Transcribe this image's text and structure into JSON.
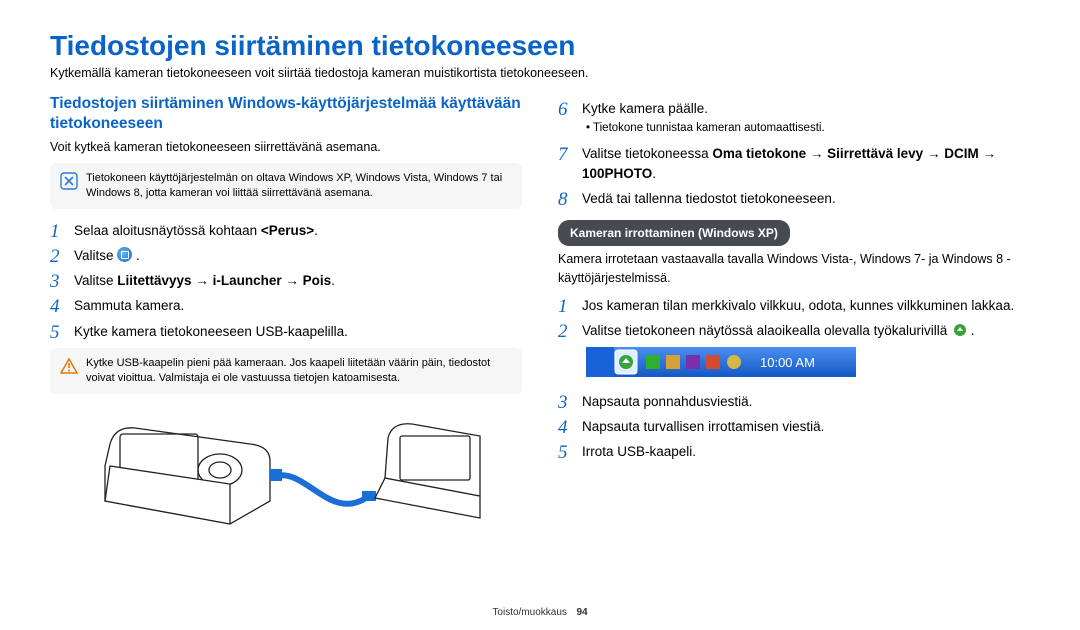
{
  "title": "Tiedostojen siirtäminen tietokoneeseen",
  "intro": "Kytkemällä kameran tietokoneeseen voit siirtää tiedostoja kameran muistikortista tietokoneeseen.",
  "left": {
    "heading": "Tiedostojen siirtäminen Windows-käyttöjärjestelmää käyttävään tietokoneeseen",
    "sub": "Voit kytkeä kameran tietokoneeseen siirrettävänä asemana.",
    "info1": "Tietokoneen käyttöjärjestelmän on oltava Windows XP, Windows Vista, Windows 7 tai Windows 8, jotta kameran voi liittää siirrettävänä asemana.",
    "s1a": "Selaa aloitusnäytössä kohtaan ",
    "s1b": "<Perus>",
    "s1c": ".",
    "s2": "Valitse ",
    "s2b": " .",
    "s3a": "Valitse ",
    "s3b": "Liitettävyys",
    "s3c": " → ",
    "s3d": "i-Launcher",
    "s3e": " → ",
    "s3f": "Pois",
    "s3g": ".",
    "s4": "Sammuta kamera.",
    "s5": "Kytke kamera tietokoneeseen USB-kaapelilla.",
    "warn": "Kytke USB-kaapelin pieni pää kameraan. Jos kaapeli liitetään väärin päin, tiedostot voivat vioittua. Valmistaja ei ole vastuussa tietojen katoamisesta."
  },
  "right": {
    "s6": "Kytke kamera päälle.",
    "s6b": "Tietokone tunnistaa kameran automaattisesti.",
    "s7a": "Valitse tietokoneessa ",
    "s7b": "Oma tietokone",
    "s7c": " → ",
    "s7d": "Siirrettävä levy",
    "s7e": " → ",
    "s7f": "DCIM",
    "s7g": " → ",
    "s7h": "100PHOTO",
    "s7i": ".",
    "s8": "Vedä tai tallenna tiedostot tietokoneeseen.",
    "pill": "Kameran irrottaminen (Windows XP)",
    "pilltxt": "Kamera irrotetaan vastaavalla tavalla Windows Vista-, Windows 7- ja Windows 8 -käyttöjärjestelmissä.",
    "d1": "Jos kameran tilan merkkivalo vilkkuu, odota, kunnes vilkkuminen lakkaa.",
    "d2": "Valitse tietokoneen näytössä alaoikealla olevalla työkalurivillä ",
    "d2b": " .",
    "clock": "10:00 AM",
    "d3": "Napsauta ponnahdusviestiä.",
    "d4": "Napsauta turvallisen irrottamisen viestiä.",
    "d5": "Irrota USB-kaapeli."
  },
  "n": {
    "1": "1",
    "2": "2",
    "3": "3",
    "4": "4",
    "5": "5",
    "6": "6",
    "7": "7",
    "8": "8"
  },
  "footer": {
    "section": "Toisto/muokkaus",
    "page": "94"
  }
}
